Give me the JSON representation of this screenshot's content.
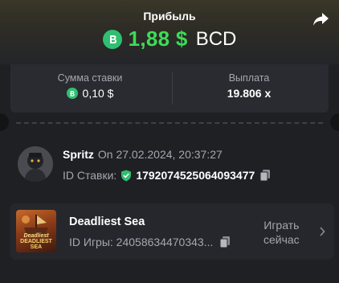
{
  "profit": {
    "title": "Прибыль",
    "amount": "1,88 $",
    "currency": "BCD",
    "amount_color": "#3ddc56",
    "coin_icon": "bcd-coin-icon"
  },
  "stats": {
    "bet_label": "Сумма ставки",
    "bet_value": "0,10 $",
    "payout_label": "Выплата",
    "payout_value": "19.806 x"
  },
  "user": {
    "name": "Spritz",
    "date": "On 27.02.2024, 20:37:27",
    "bet_id_label": "ID Ставки:",
    "bet_id": "1792074525064093477"
  },
  "game": {
    "name": "Deadliest Sea",
    "game_id": "ID Игры: 24058634470343...",
    "play_line1": "Играть",
    "play_line2": "сейчас",
    "thumb_line1": "Deadliest",
    "thumb_line2": "DEADLIEST SEA"
  }
}
